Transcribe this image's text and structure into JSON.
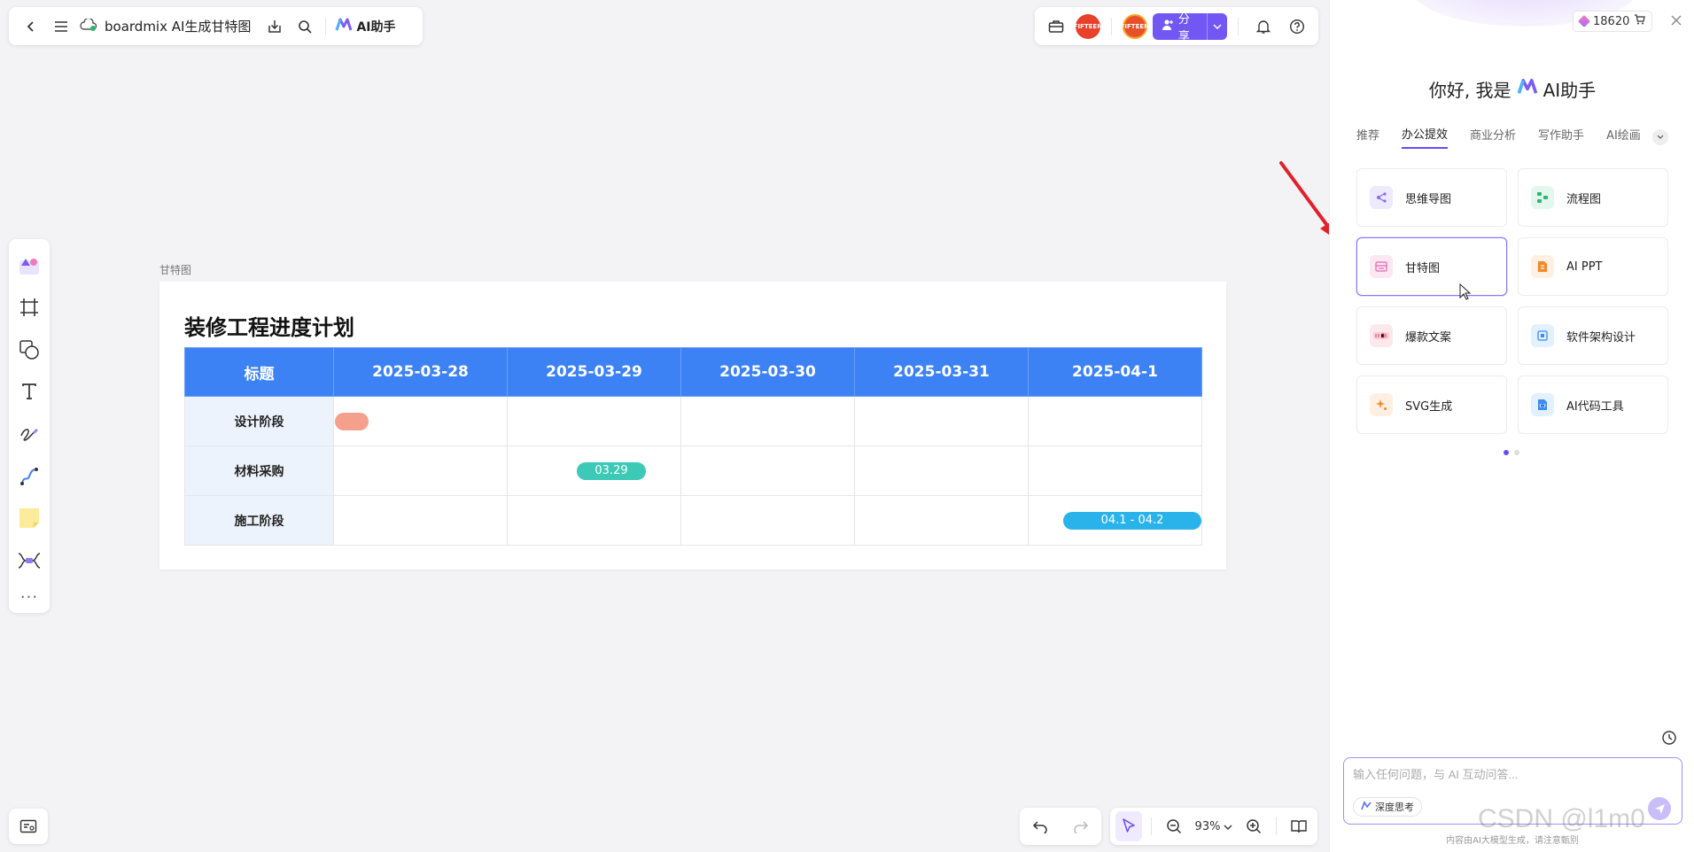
{
  "topbar": {
    "doc_title": "boardmix AI生成甘特图",
    "ai_label": "AI助手"
  },
  "topbar_right": {
    "avatar1": "FIFTEEN",
    "avatar2": "FIFTEEN",
    "share_label": "分享"
  },
  "zoom": {
    "level": "93%"
  },
  "frame": {
    "label": "甘特图",
    "title": "装修工程进度计划"
  },
  "gantt": {
    "header_first": "标题",
    "dates": [
      "2025-03-28",
      "2025-03-29",
      "2025-03-30",
      "2025-03-31",
      "2025-04-1"
    ],
    "rows": [
      {
        "label": "设计阶段",
        "bar_text": ""
      },
      {
        "label": "材料采购",
        "bar_text": "03.29"
      },
      {
        "label": "施工阶段",
        "bar_text": "04.1 - 04.2"
      }
    ],
    "colors": {
      "header": "#3d82f5",
      "bar1": "#f5a08c",
      "bar2": "#3cc9b5",
      "bar3": "#2ab3ea"
    }
  },
  "ai_panel": {
    "credits": "18620",
    "greeting_prefix": "你好, 我是",
    "greeting_brand": "AI助手",
    "tabs": [
      "推荐",
      "办公提效",
      "商业分析",
      "写作助手",
      "AI绘画"
    ],
    "active_tab": "办公提效",
    "cards": [
      {
        "label": "思维导图",
        "icon": "mindmap-icon"
      },
      {
        "label": "流程图",
        "icon": "flowchart-icon"
      },
      {
        "label": "甘特图",
        "icon": "gantt-icon"
      },
      {
        "label": "AI PPT",
        "icon": "ppt-icon"
      },
      {
        "label": "爆款文案",
        "icon": "xiaohongshu-icon"
      },
      {
        "label": "软件架构设计",
        "icon": "architecture-icon"
      },
      {
        "label": "SVG生成",
        "icon": "svg-icon"
      },
      {
        "label": "AI代码工具",
        "icon": "code-icon"
      }
    ],
    "input_placeholder": "输入任何问题，与 AI 互动问答...",
    "deep_think": "深度思考",
    "footnote": "内容由AI大模型生成，请注意甄别"
  },
  "watermark": "CSDN @l1m0",
  "accent": "#7257f5"
}
